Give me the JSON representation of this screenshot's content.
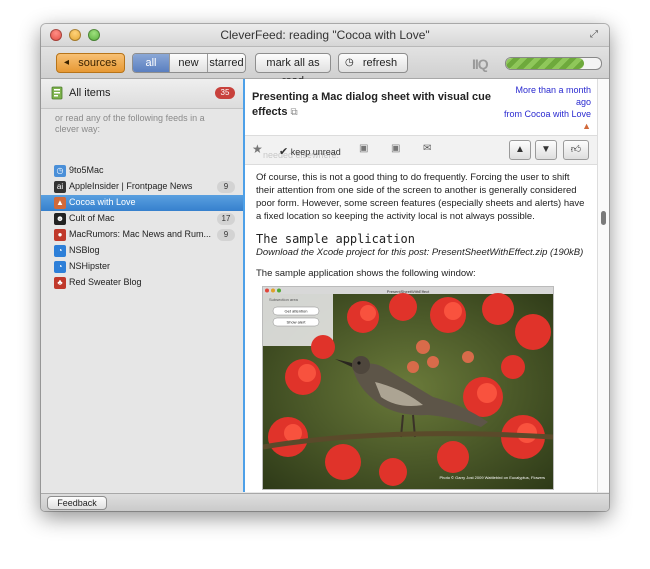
{
  "window": {
    "title": "CleverFeed: reading \"Cocoa with Love\""
  },
  "toolbar": {
    "sources_label": "sources",
    "filters": [
      "all",
      "new",
      "starred"
    ],
    "active_filter": "all",
    "mark_all_label": "mark all as read",
    "refresh_label": "refresh",
    "iq_logo": "IIQ",
    "iq_progress": 0.82
  },
  "sidebar": {
    "all_items_label": "All items",
    "all_items_count": "35",
    "hint": "or read any of the following feeds in a clever way:",
    "feeds": [
      {
        "label": "9to5Mac",
        "count": "",
        "icon": "clock-icon",
        "color": "#4a8fd8"
      },
      {
        "label": "AppleInsider | Frontpage News",
        "count": "9",
        "icon": "ai-icon",
        "color": "#333333"
      },
      {
        "label": "Cocoa with Love",
        "count": "",
        "icon": "cocoa-icon",
        "color": "#d2693a",
        "selected": true
      },
      {
        "label": "Cult of Mac",
        "count": "17",
        "icon": "cultofmac-icon",
        "color": "#222222"
      },
      {
        "label": "MacRumors: Mac News and Rum...",
        "count": "9",
        "icon": "macrumors-icon",
        "color": "#c0392b"
      },
      {
        "label": "NSBlog",
        "count": "",
        "icon": "rss-icon",
        "color": "#2d7fd8"
      },
      {
        "label": "NSHipster",
        "count": "",
        "icon": "rss-icon",
        "color": "#2d7fd8"
      },
      {
        "label": "Red Sweater Blog",
        "count": "",
        "icon": "red-sweater-icon",
        "color": "#c0392b"
      }
    ]
  },
  "article": {
    "title": "Presenting a Mac dialog sheet with visual cue effects",
    "meta_age": "More than a month ago",
    "meta_source": "from Cocoa with Love",
    "ghost_text": "needed elsewhere.",
    "keep_unread_label": "keep unread",
    "paragraph1": "Of course, this is not a good thing to do frequently. Forcing the user to shift their attention from one side of the screen to another is generally considered poor form. However, some screen features (especially sheets and alerts) have a fixed location so keeping the activity local is not always possible.",
    "heading": "The sample application",
    "download": "Download the Xcode project for this post: PresentSheetWithEffect.zip (190kB)",
    "paragraph2": "The sample application shows the following window:",
    "screenshot": {
      "window_title": "PresentSheetWithEffect",
      "group_label": "Subsection area",
      "button1": "Get attention",
      "button2": "Show alert",
      "caption": "Photo © Garry Jost 2009 Wattlebird on Eucalyptus, Flowers"
    }
  },
  "status": {
    "feedback_label": "Feedback"
  }
}
